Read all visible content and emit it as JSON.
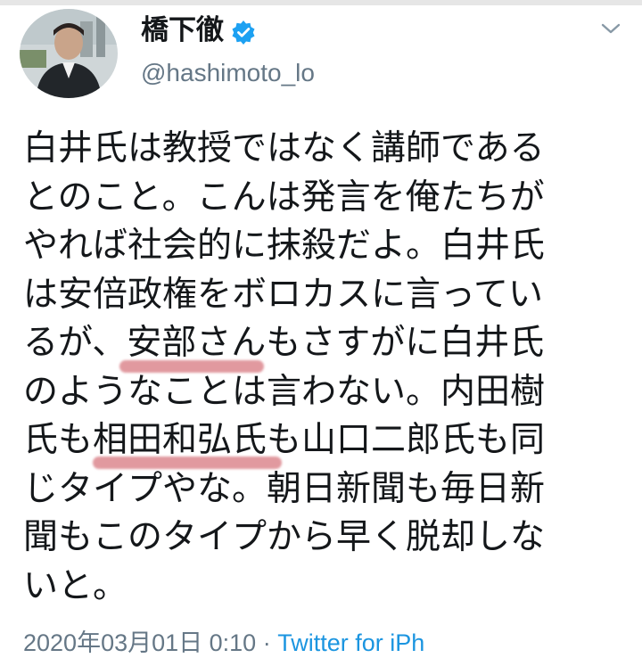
{
  "user": {
    "display_name": "橋下徹",
    "handle": "@hashimoto_lo",
    "verified": true,
    "avatar": "profile-photo"
  },
  "tweet": {
    "lines": [
      "白井氏は教授ではなく講師である",
      "とのこと。こんは発言を俺たちが",
      "やれば社会的に抹殺だよ。白井氏",
      "は安倍政権をボロカスに言ってい",
      "るが、安部さんもさすがに白井氏",
      "のようなことは言わない。内田樹",
      "氏も相田和弘氏も山口二郎氏も同",
      "じタイプやな。朝日新聞も毎日新",
      "聞もこのタイプから早く脱却しな",
      "いと。"
    ],
    "highlights": [
      "安部さん",
      "相田和弘氏"
    ],
    "highlight_color": "#c84650"
  },
  "footer": {
    "timestamp": "2020年03月01日 0:10",
    "separator": " · ",
    "source": "Twitter for iPh"
  },
  "icons": {
    "verified": "verified-badge-icon",
    "menu": "chevron-down-icon"
  },
  "colors": {
    "text": "#14171a",
    "secondary": "#657786",
    "verified_blue": "#1da1f2"
  }
}
